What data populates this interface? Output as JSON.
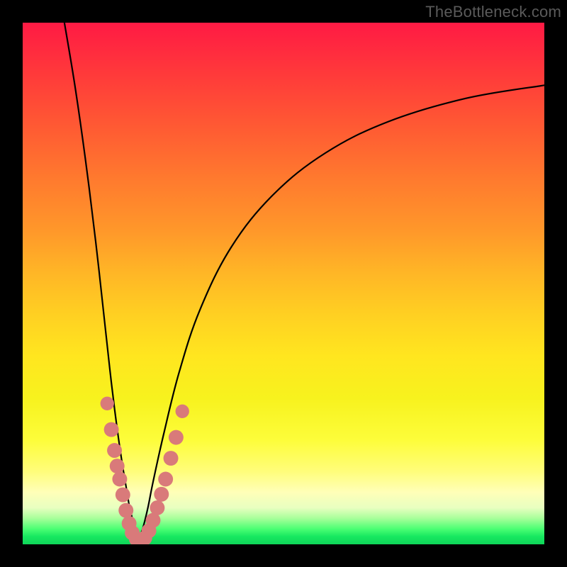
{
  "watermark": "TheBottleneck.com",
  "colors": {
    "frame": "#000000",
    "curve": "#000000",
    "bead": "#d97a7a",
    "gradient_top": "#ff1a44",
    "gradient_bottom": "#0fd659"
  },
  "chart_data": {
    "type": "line",
    "title": "",
    "xlabel": "",
    "ylabel": "",
    "xlim": [
      0,
      100
    ],
    "ylim": [
      0,
      100
    ],
    "grid": false,
    "legend": false,
    "note": "bottleneck curve; minimum (y≈0, green zone) near x≈22; both branches rise toward the red zone",
    "series": [
      {
        "name": "left-branch",
        "x": [
          8,
          10,
          12,
          14,
          16,
          17,
          18,
          19,
          20,
          20.5,
          21,
          21.5,
          22
        ],
        "y": [
          100,
          88,
          74,
          58,
          40,
          31,
          23,
          16,
          10,
          7,
          5,
          2.5,
          0.5
        ]
      },
      {
        "name": "right-branch",
        "x": [
          22,
          23,
          24,
          25,
          27,
          30,
          34,
          40,
          48,
          58,
          70,
          85,
          100
        ],
        "y": [
          0.5,
          3,
          7,
          12,
          21,
          33,
          45,
          57,
          67,
          75,
          81,
          85.5,
          88
        ]
      }
    ],
    "beads": [
      {
        "x": 16.2,
        "y": 27,
        "r": 1.4
      },
      {
        "x": 17.0,
        "y": 22,
        "r": 1.6
      },
      {
        "x": 17.6,
        "y": 18,
        "r": 1.6
      },
      {
        "x": 18.1,
        "y": 15,
        "r": 1.6
      },
      {
        "x": 18.6,
        "y": 12.5,
        "r": 1.6
      },
      {
        "x": 19.2,
        "y": 9.5,
        "r": 1.6
      },
      {
        "x": 19.8,
        "y": 6.5,
        "r": 1.6
      },
      {
        "x": 20.4,
        "y": 4.0,
        "r": 1.6
      },
      {
        "x": 21.0,
        "y": 2.2,
        "r": 1.6
      },
      {
        "x": 21.8,
        "y": 1.0,
        "r": 1.6
      },
      {
        "x": 22.6,
        "y": 0.6,
        "r": 1.6
      },
      {
        "x": 23.4,
        "y": 1.2,
        "r": 1.6
      },
      {
        "x": 24.2,
        "y": 2.6,
        "r": 1.6
      },
      {
        "x": 25.0,
        "y": 4.6,
        "r": 1.6
      },
      {
        "x": 25.8,
        "y": 7.0,
        "r": 1.6
      },
      {
        "x": 26.6,
        "y": 9.6,
        "r": 1.6
      },
      {
        "x": 27.4,
        "y": 12.5,
        "r": 1.6
      },
      {
        "x": 28.4,
        "y": 16.5,
        "r": 1.6
      },
      {
        "x": 29.4,
        "y": 20.5,
        "r": 1.6
      },
      {
        "x": 30.6,
        "y": 25.5,
        "r": 1.4
      }
    ]
  }
}
